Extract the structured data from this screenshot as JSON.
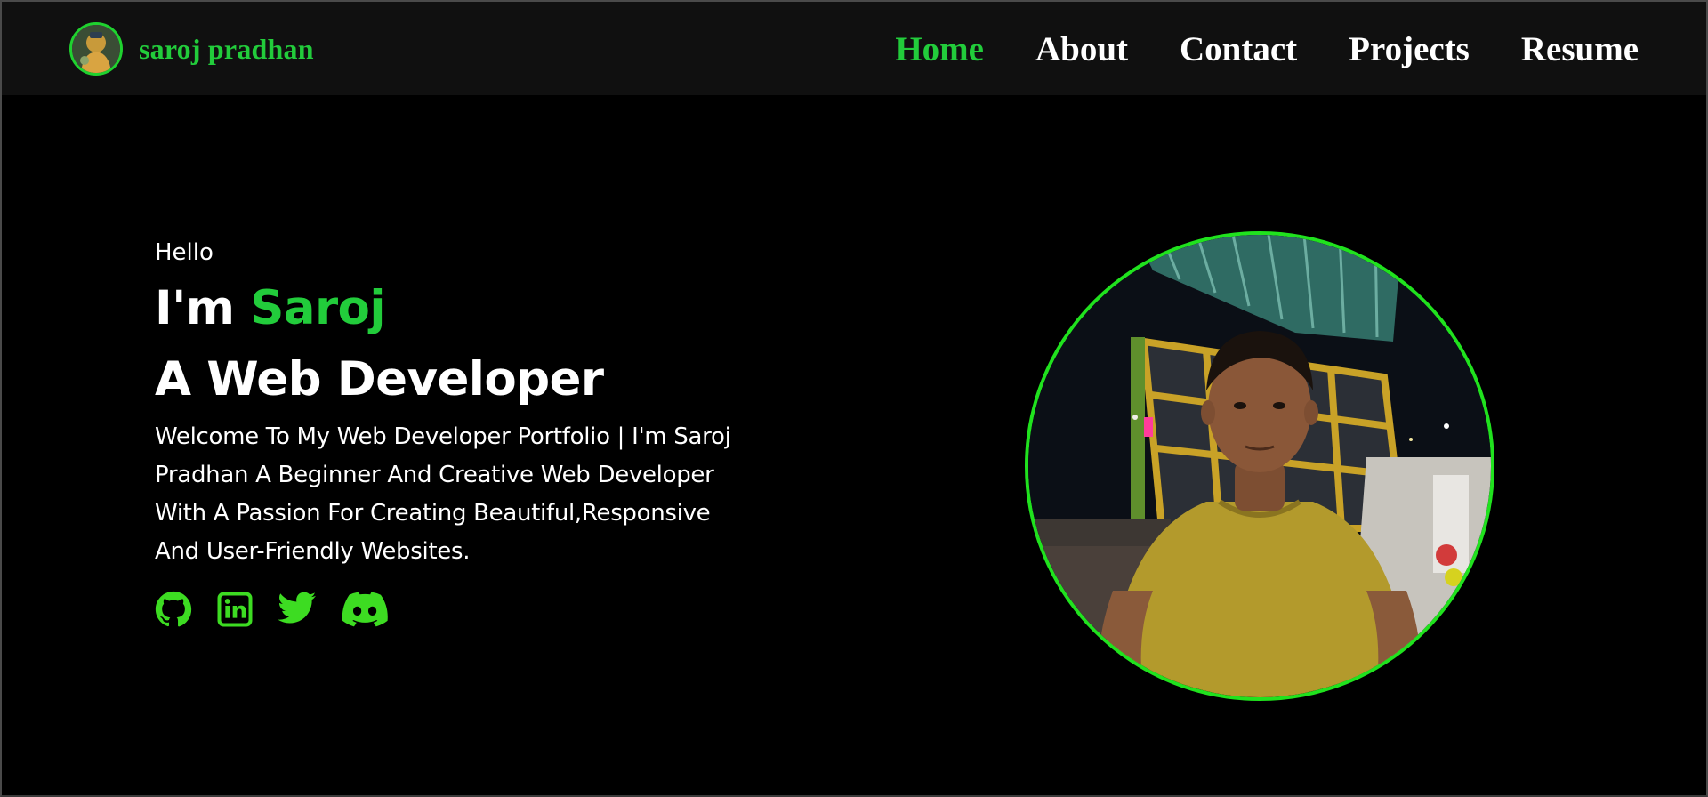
{
  "navbar": {
    "brand_name": "saroj pradhan",
    "links": [
      {
        "label": "Home",
        "active": true
      },
      {
        "label": "About",
        "active": false
      },
      {
        "label": "Contact",
        "active": false
      },
      {
        "label": "Projects",
        "active": false
      },
      {
        "label": "Resume",
        "active": false
      }
    ]
  },
  "hero": {
    "greeting": "Hello",
    "title_prefix": "I'm ",
    "title_name": "Saroj",
    "subtitle": "A Web Developer",
    "intro": "Welcome To My Web Developer Portfolio | I'm Saroj Pradhan A Beginner And Creative Web Developer With A Passion For Creating Beautiful,Responsive And User-Friendly Websites.",
    "socials": [
      {
        "icon": "github-icon"
      },
      {
        "icon": "linkedin-icon"
      },
      {
        "icon": "twitter-icon"
      },
      {
        "icon": "discord-icon"
      }
    ]
  },
  "colors": {
    "accent": "#22cc3b",
    "icon_green": "#3ddc22",
    "portrait_border": "#20e21e",
    "navbar_bg": "#101010",
    "page_bg": "#000000"
  }
}
